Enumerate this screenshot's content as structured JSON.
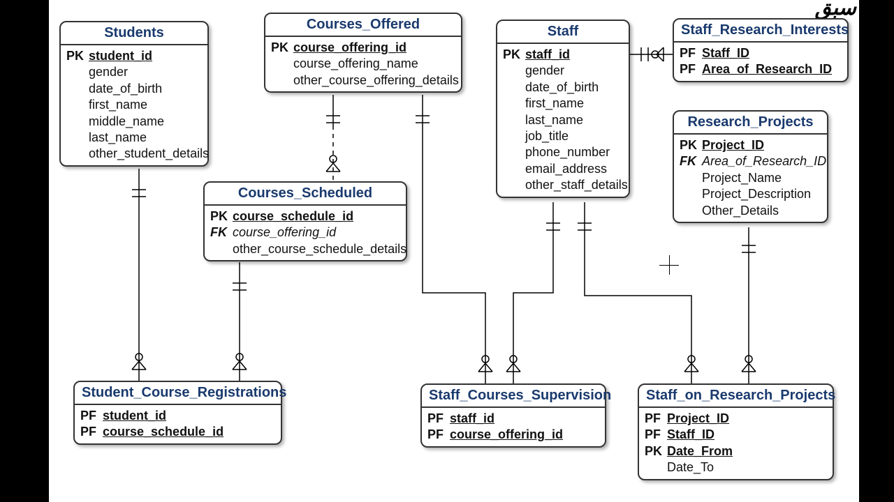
{
  "watermark": "سبق",
  "entities": {
    "students": {
      "title": "Students",
      "attrs": [
        {
          "key": "PK",
          "name": "student_id",
          "u": true
        },
        {
          "key": "",
          "name": "gender"
        },
        {
          "key": "",
          "name": "date_of_birth"
        },
        {
          "key": "",
          "name": "first_name"
        },
        {
          "key": "",
          "name": "middle_name"
        },
        {
          "key": "",
          "name": "last_name"
        },
        {
          "key": "",
          "name": "other_student_details"
        }
      ]
    },
    "courses_offered": {
      "title": "Courses_Offered",
      "attrs": [
        {
          "key": "PK",
          "name": "course_offering_id",
          "u": true
        },
        {
          "key": "",
          "name": "course_offering_name"
        },
        {
          "key": "",
          "name": "other_course_offering_details"
        }
      ]
    },
    "staff": {
      "title": "Staff",
      "attrs": [
        {
          "key": "PK",
          "name": "staff_id",
          "u": true
        },
        {
          "key": "",
          "name": "gender"
        },
        {
          "key": "",
          "name": "date_of_birth"
        },
        {
          "key": "",
          "name": "first_name"
        },
        {
          "key": "",
          "name": "last_name"
        },
        {
          "key": "",
          "name": "job_title"
        },
        {
          "key": "",
          "name": "phone_number"
        },
        {
          "key": "",
          "name": "email_address"
        },
        {
          "key": "",
          "name": "other_staff_details"
        }
      ]
    },
    "staff_research_interests": {
      "title": "Staff_Research_Interests",
      "attrs": [
        {
          "key": "PF",
          "name": "Staff_ID",
          "u": true
        },
        {
          "key": "PF",
          "name": "Area_of_Research_ID",
          "u": true
        }
      ]
    },
    "research_projects": {
      "title": "Research_Projects",
      "attrs": [
        {
          "key": "PK",
          "name": "Project_ID",
          "u": true
        },
        {
          "key": "FK",
          "name": "Area_of_Research_ID",
          "i": true,
          "fk": true
        },
        {
          "key": "",
          "name": "Project_Name"
        },
        {
          "key": "",
          "name": "Project_Description"
        },
        {
          "key": "",
          "name": "Other_Details"
        }
      ]
    },
    "courses_scheduled": {
      "title": "Courses_Scheduled",
      "attrs": [
        {
          "key": "PK",
          "name": "course_schedule_id",
          "u": true
        },
        {
          "key": "FK",
          "name": "course_offering_id",
          "i": true,
          "fk": true
        },
        {
          "key": "",
          "name": "other_course_schedule_details"
        }
      ]
    },
    "student_course_registrations": {
      "title": "Student_Course_Registrations",
      "attrs": [
        {
          "key": "PF",
          "name": "student_id",
          "u": true
        },
        {
          "key": "PF",
          "name": "course_schedule_id",
          "u": true
        }
      ]
    },
    "staff_courses_supervision": {
      "title": "Staff_Courses_Supervision",
      "attrs": [
        {
          "key": "PF",
          "name": "staff_id",
          "u": true
        },
        {
          "key": "PF",
          "name": "course_offering_id",
          "u": true
        }
      ]
    },
    "staff_on_research_projects": {
      "title": "Staff_on_Research_Projects",
      "attrs": [
        {
          "key": "PF",
          "name": "Project_ID",
          "u": true
        },
        {
          "key": "PF",
          "name": "Staff_ID",
          "u": true
        },
        {
          "key": "PK",
          "name": "Date_From",
          "u": true
        },
        {
          "key": "",
          "name": "Date_To"
        }
      ]
    }
  }
}
